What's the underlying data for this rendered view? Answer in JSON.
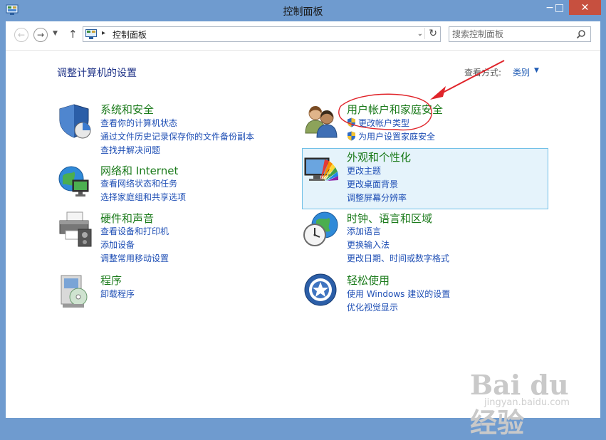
{
  "window": {
    "title": "控制面板"
  },
  "titlebar": {
    "minimize": "−",
    "maximize": "□",
    "close": "✕"
  },
  "toolbar": {
    "address_sep": "▸",
    "address_text": "控制面板",
    "search_placeholder": "搜索控制面板"
  },
  "main": {
    "heading": "调整计算机的设置",
    "view_by_label": "查看方式:",
    "view_by_value": "类别"
  },
  "categories": [
    {
      "title": "系统和安全",
      "icon": "shield-icon",
      "links": [
        "查看你的计算机状态",
        "通过文件历史记录保存你的文件备份副本",
        "查找并解决问题"
      ]
    },
    {
      "title": "网络和 Internet",
      "icon": "network-globe-icon",
      "links": [
        "查看网络状态和任务",
        "选择家庭组和共享选项"
      ]
    },
    {
      "title": "硬件和声音",
      "icon": "printer-icon",
      "links": [
        "查看设备和打印机",
        "添加设备",
        "调整常用移动设置"
      ]
    },
    {
      "title": "程序",
      "icon": "programs-icon",
      "links": [
        "卸载程序"
      ]
    },
    {
      "title": "用户帐户和家庭安全",
      "icon": "users-icon",
      "links": [
        "更改帐户类型",
        "为用户设置家庭安全"
      ]
    },
    {
      "title": "外观和个性化",
      "icon": "monitor-palette-icon",
      "links": [
        "更改主题",
        "更改桌面背景",
        "调整屏幕分辨率"
      ]
    },
    {
      "title": "时钟、语言和区域",
      "icon": "clock-globe-icon",
      "links": [
        "添加语言",
        "更换输入法",
        "更改日期、时间或数字格式"
      ]
    },
    {
      "title": "轻松使用",
      "icon": "ease-of-access-icon",
      "links": [
        "使用 Windows 建议的设置",
        "优化视觉显示"
      ]
    }
  ],
  "watermark": {
    "main": "Bai du 经验",
    "sub": "jingyan.baidu.com"
  },
  "colors": {
    "accent_link": "#1f4fb5",
    "category_title": "#1a7a1a",
    "annotation": "#e0242a",
    "titlebar": "#6f9bcf"
  }
}
